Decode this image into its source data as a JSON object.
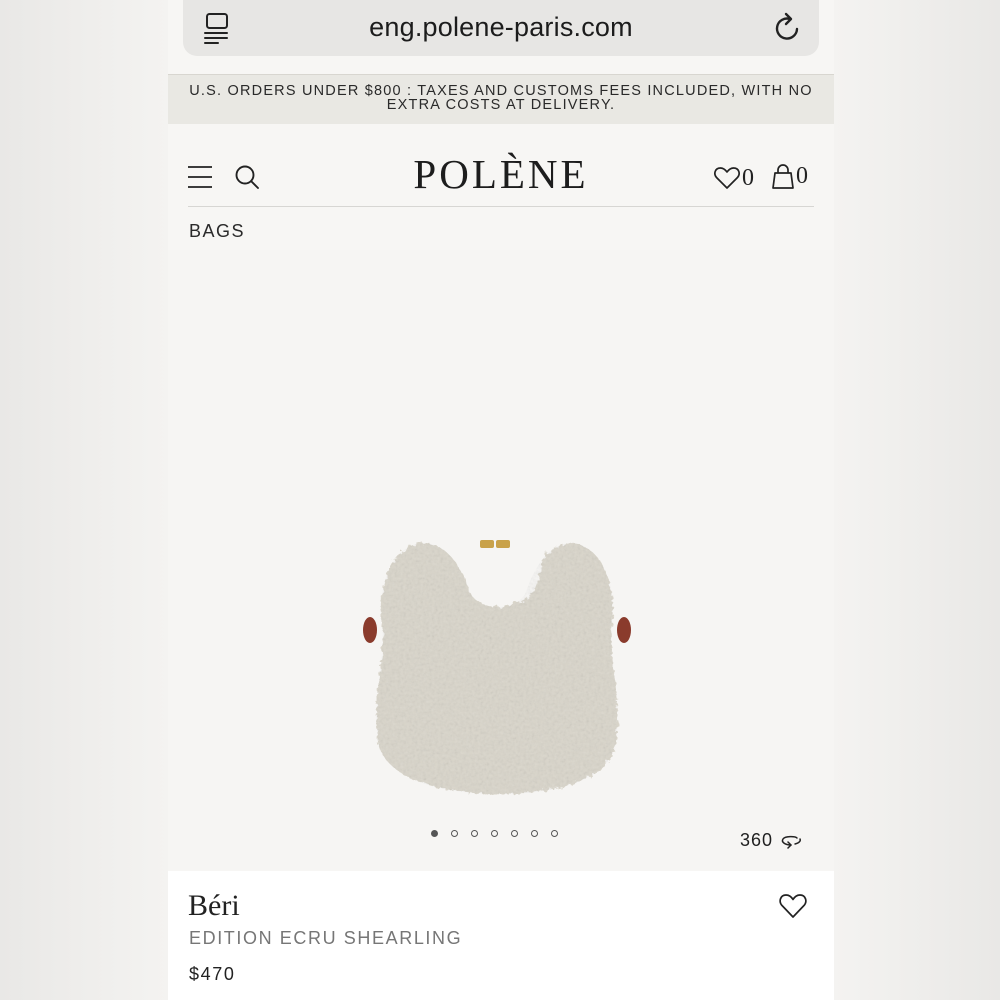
{
  "browser": {
    "url": "eng.polene-paris.com",
    "icons": [
      "reader-mode-icon",
      "reload-icon"
    ]
  },
  "announcement": {
    "text": "U.S. ORDERS UNDER $800 : TAXES AND CUSTOMS FEES INCLUDED, WITH NO EXTRA COSTS AT DELIVERY."
  },
  "header": {
    "logo": "POLÈNE",
    "wishlist_count": "0",
    "cart_count": "0",
    "icons": [
      "menu-icon",
      "search-icon",
      "heart-icon",
      "bag-icon"
    ]
  },
  "breadcrumb": "BAGS",
  "gallery": {
    "slide_count": 7,
    "active_index": 0,
    "rotate_label": "360",
    "bag_color": "#d6d2c6"
  },
  "product": {
    "name": "Béri",
    "edition": "EDITION ECRU SHEARLING",
    "price": "$470"
  }
}
